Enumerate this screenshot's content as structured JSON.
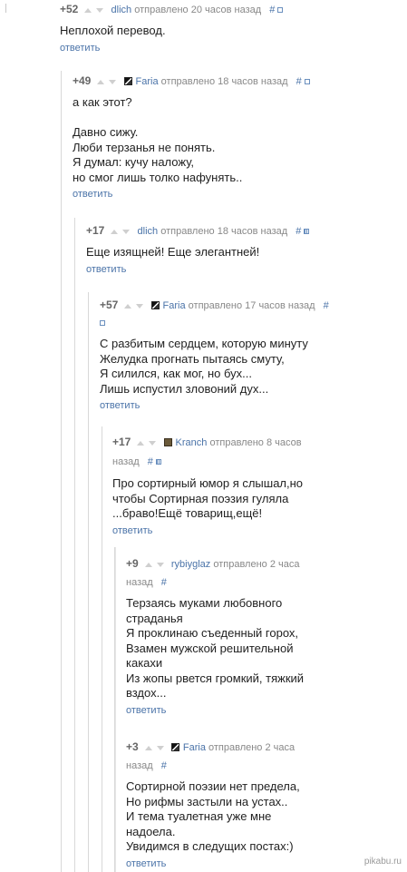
{
  "comments": [
    {
      "rating": "+52",
      "author": "dlich",
      "meta": "отправлено 20 часов назад",
      "hash": "#",
      "text": "Неплохой перевод.",
      "reply": "ответить"
    },
    {
      "rating": "+49",
      "author": "Faria",
      "meta": "отправлено 18 часов назад",
      "hash": "#",
      "text": "а как этот?\n\nДавно сижу.\nЛюби терзанья не понять.\nЯ думал: кучу наложу,\nно смог лишь толко нафунять..",
      "reply": "ответить"
    },
    {
      "rating": "+17",
      "author": "dlich",
      "meta": "отправлено 18 часов назад",
      "hash": "#",
      "text": "Еще изящней! Еще элегантней!",
      "reply": "ответить"
    },
    {
      "rating": "+57",
      "author": "Faria",
      "meta": "отправлено 17 часов назад",
      "hash": "#",
      "text": "С разбитым сердцем, которую минуту\nЖелудка прогнать пытаясь смуту,\nЯ силился, как мог, но бух...\nЛишь испустил зловоний дух...",
      "reply": "ответить"
    },
    {
      "rating": "+17",
      "author": "Kranch",
      "meta": "отправлено 8 часов назад",
      "hash": "#",
      "text": "Про сортирный юмор я слышал,но\nчтобы Сортирная поэзия гуляла\n...браво!Ещё товарищ,ещё!",
      "reply": "ответить"
    },
    {
      "rating": "+9",
      "author": "rybiyglaz",
      "meta": "отправлено 2 часа назад",
      "hash": "#",
      "text": "Терзаясь муками любовного\nстраданья\nЯ проклинаю съеденный горох,\nВзамен мужской решительной\nкакахи\nИз жопы рвется громкий, тяжкий\nвздох...",
      "reply": "ответить"
    },
    {
      "rating": "+3",
      "author": "Faria",
      "meta": "отправлено 2 часа назад",
      "hash": "#",
      "text": "Сортирной поэзии нет предела,\nНо рифмы застыли на устах..\nИ тема туалетная уже мне\nнадоела.\nУвидимся в следущих постах:)",
      "reply": "ответить"
    }
  ],
  "watermark": "pikabu.ru"
}
